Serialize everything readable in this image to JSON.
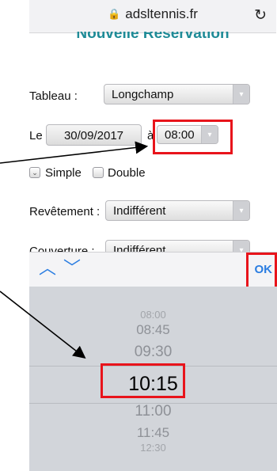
{
  "browser": {
    "host": "adsltennis.fr",
    "lock_icon": "lock-icon",
    "reload_icon": "reload-icon"
  },
  "page": {
    "title": "Nouvelle Réservation"
  },
  "form": {
    "tableau_label": "Tableau :",
    "tableau_value": "Longchamp",
    "le_label": "Le",
    "date_value": "30/09/2017",
    "a_label": "à",
    "time_value": "08:00",
    "simple_label": "Simple",
    "simple_checked": true,
    "double_label": "Double",
    "double_checked": false,
    "revetement_label": "Revêtement :",
    "revetement_value": "Indifférent",
    "couverture_label": "Couverture :",
    "couverture_value": "Indifférent"
  },
  "picker": {
    "ok_label": "OK",
    "times": [
      "08:00",
      "08:45",
      "09:30",
      "10:15",
      "11:00",
      "11:45",
      "12:30"
    ],
    "selected": "10:15"
  },
  "colors": {
    "accent": "#1f8b97",
    "ios_blue": "#2a7de1",
    "highlight_red": "#e8141b"
  }
}
